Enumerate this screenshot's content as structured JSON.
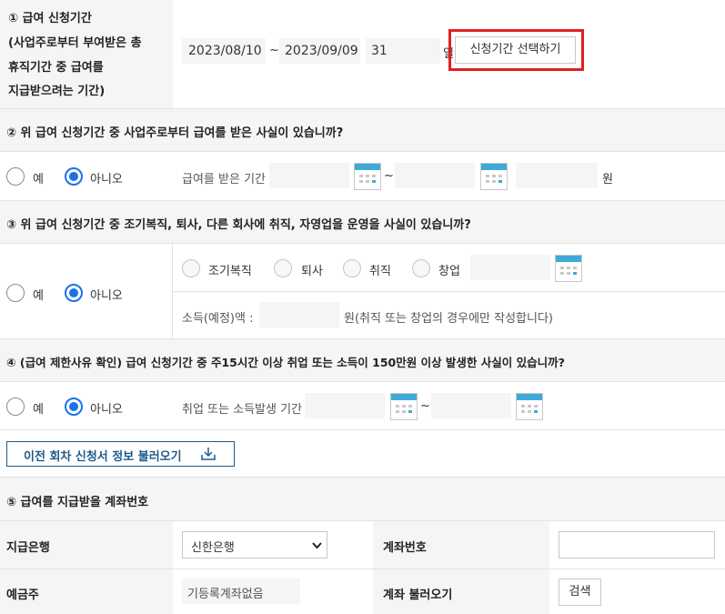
{
  "s1": {
    "label_lines": [
      "① 급여 신청기간",
      "(사업주로부터 부여받은 총",
      "휴직기간 중 급여를",
      "지급받으려는 기간)"
    ],
    "start_date": "2023/08/10",
    "tilde": "~",
    "end_date": "2023/09/09",
    "days": "31",
    "day_unit": "일",
    "select_period_btn": "신청기간 선택하기"
  },
  "s2": {
    "question": "② 위 급여 신청기간 중 사업주로부터 급여를 받은 사실이 있습니까?",
    "yes": "예",
    "no": "아니오",
    "period_label": "급여를 받은 기간",
    "tilde": "~",
    "won": "원"
  },
  "s3": {
    "question": "③ 위 급여 신청기간 중 조기복직, 퇴사, 다른 회사에 취직, 자영업을 운영을 사실이 있습니까?",
    "yes": "예",
    "no": "아니오",
    "opt_return": "조기복직",
    "opt_resign": "퇴사",
    "opt_employ": "취직",
    "opt_startup": "창업",
    "income_label": "소득(예정)액 :",
    "income_note": "원(취직 또는 창업의 경우에만 작성합니다)"
  },
  "s4": {
    "question": "④ (급여 제한사유 확인) 급여 신청기간 중 주15시간 이상 취업 또는 소득이 150만원 이상 발생한 사실이 있습니까?",
    "yes": "예",
    "no": "아니오",
    "period_label": "취업 또는 소득발생 기간",
    "tilde": "~"
  },
  "load_prev_btn": "이전 회차 신청서 정보 불러오기",
  "s5": {
    "title": "⑤ 급여를 지급받을 계좌번호",
    "bank_label": "지급은행",
    "bank_value": "신한은행",
    "account_label": "계좌번호",
    "holder_label": "예금주",
    "holder_value": "기등록계좌없음",
    "load_account_label": "계좌 불러오기",
    "search_btn": "검색"
  },
  "colors": {
    "accent": "#1a73e8",
    "highlight": "#e02020",
    "navy": "#1e5a8c",
    "calendar": "#3fa9d8"
  }
}
